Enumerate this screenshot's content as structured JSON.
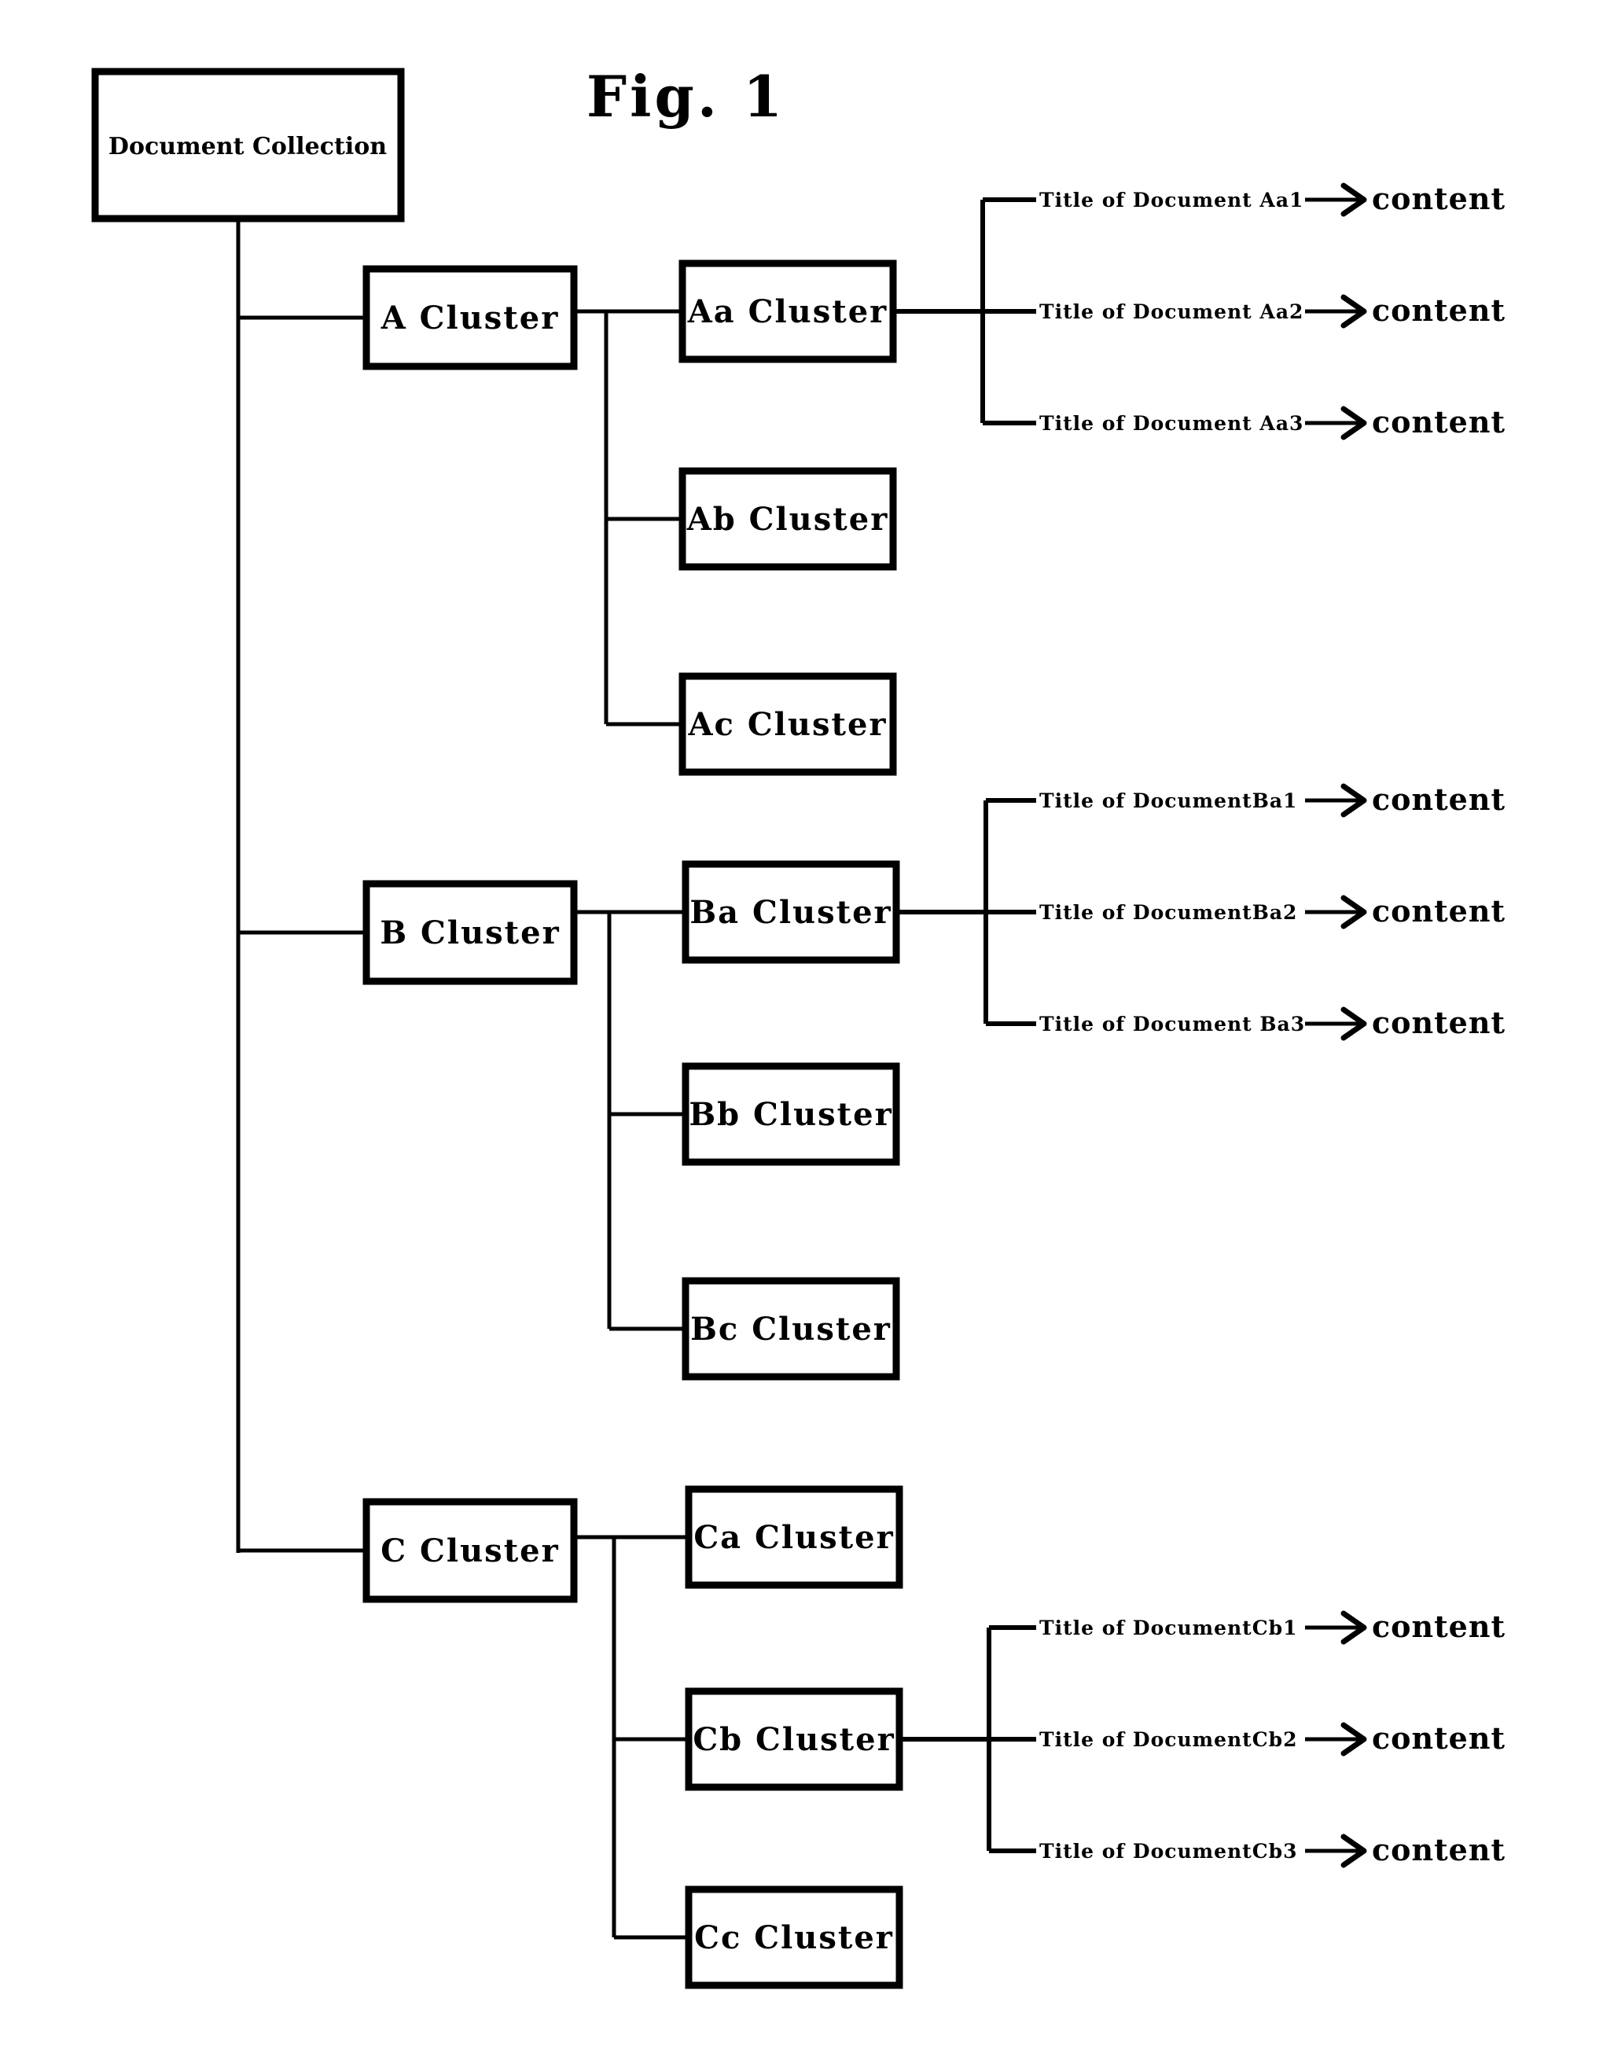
{
  "figure": {
    "title": "Fig. 1"
  },
  "root": {
    "label": "Document Collection"
  },
  "clusters": [
    {
      "label": "A Cluster",
      "children": [
        {
          "label": "Aa Cluster",
          "documents": [
            {
              "title": "Title of Document Aa1",
              "target": "content"
            },
            {
              "title": "Title of Document Aa2",
              "target": "content"
            },
            {
              "title": "Title of Document Aa3",
              "target": "content"
            }
          ]
        },
        {
          "label": "Ab Cluster",
          "documents": []
        },
        {
          "label": "Ac Cluster",
          "documents": []
        }
      ]
    },
    {
      "label": "B Cluster",
      "children": [
        {
          "label": "Ba Cluster",
          "documents": [
            {
              "title": "Title of DocumentBa1",
              "target": "content"
            },
            {
              "title": "Title of DocumentBa2",
              "target": "content"
            },
            {
              "title": "Title of Document Ba3",
              "target": "content"
            }
          ]
        },
        {
          "label": "Bb Cluster",
          "documents": []
        },
        {
          "label": "Bc Cluster",
          "documents": []
        }
      ]
    },
    {
      "label": "C Cluster",
      "children": [
        {
          "label": "Ca Cluster",
          "documents": []
        },
        {
          "label": "Cb Cluster",
          "documents": [
            {
              "title": "Title of DocumentCb1",
              "target": "content"
            },
            {
              "title": "Title of DocumentCb2",
              "target": "content"
            },
            {
              "title": "Title of DocumentCb3",
              "target": "content"
            }
          ]
        },
        {
          "label": "Cc Cluster",
          "documents": []
        }
      ]
    }
  ]
}
